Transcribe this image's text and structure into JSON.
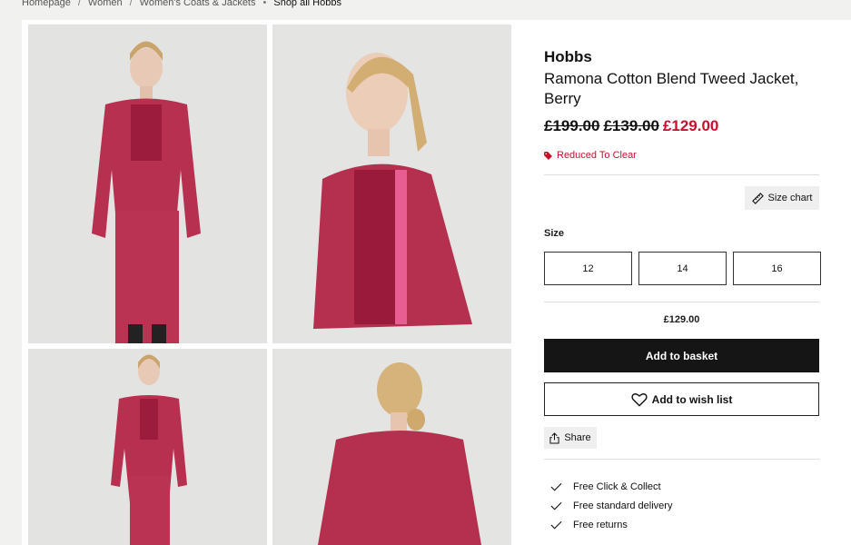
{
  "breadcrumb": {
    "items": [
      "Homepage",
      "Women",
      "Women's Coats & Jackets"
    ],
    "current": "Shop all Hobbs"
  },
  "gallery": {
    "images": [
      "Model front view wearing berry tweed jacket and skirt",
      "Model three-quarter view close-up",
      "Model full-length front view",
      "Model rear view"
    ]
  },
  "product": {
    "brand": "Hobbs",
    "name": "Ramona Cotton Blend Tweed Jacket, Berry",
    "price_was_1": "£199.00",
    "price_was_2": "£139.00",
    "price_now": "£129.00",
    "promo": "Reduced To Clear",
    "size_chart_label": "Size chart",
    "size_label": "Size",
    "sizes": [
      "12",
      "14",
      "16"
    ],
    "selected_price": "£129.00",
    "add_to_basket": "Add to basket",
    "add_to_wishlist": "Add to wish list",
    "share": "Share",
    "benefits": [
      "Free Click & Collect",
      "Free standard delivery",
      "Free returns"
    ]
  },
  "colors": {
    "sale_red": "#c8102e",
    "primary_button": "#151515",
    "jacket_berry": "#b8304f"
  }
}
